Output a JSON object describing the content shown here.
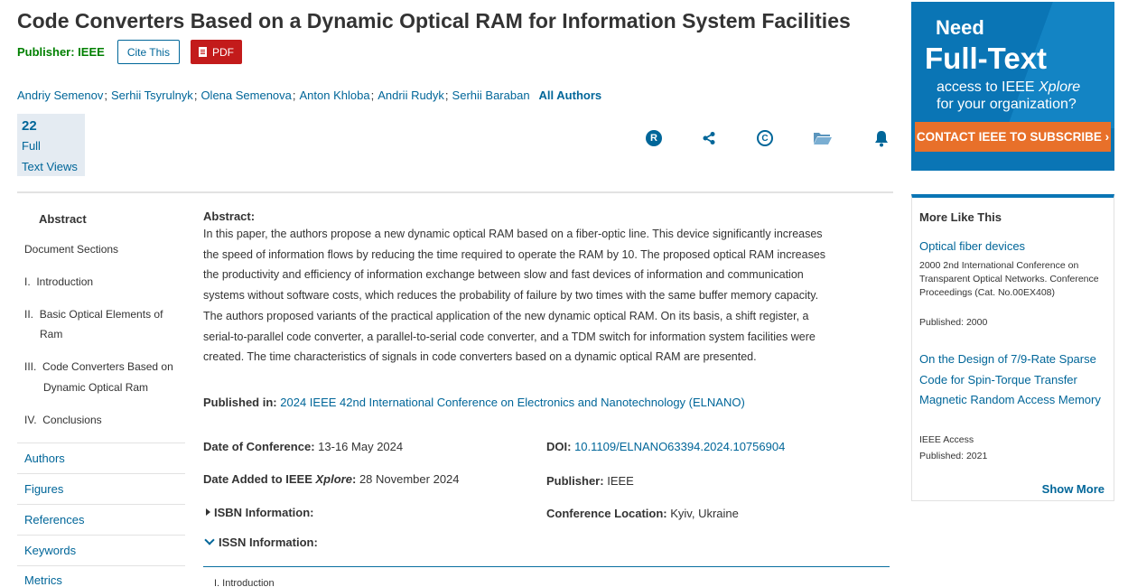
{
  "article": {
    "title": "Code Converters Based on a Dynamic Optical RAM for Information System Facilities",
    "publisher_label": "Publisher: IEEE",
    "cite_label": "Cite This",
    "pdf_label": "PDF",
    "authors": [
      "Andriy Semenov",
      "Serhii Tsyrulnyk",
      "Olena Semenova",
      "Anton Khloba",
      "Andrii Rudyk",
      "Serhii Baraban"
    ],
    "author_sep": ";",
    "all_authors_label": "All Authors",
    "views_count": "22",
    "views_label_1": "Full",
    "views_label_2": "Text Views"
  },
  "toolbar_icons": [
    "rights-icon",
    "share-icon",
    "copyright-icon",
    "folder-icon",
    "alert-bell-icon"
  ],
  "toolbar": {
    "rights_glyph": "R",
    "copyright_glyph": "C"
  },
  "nav": {
    "abstract": "Abstract",
    "document_sections": "Document Sections",
    "sections": [
      {
        "num": "I.",
        "title": "Introduction"
      },
      {
        "num": "II.",
        "title": "Basic Optical Elements of",
        "title2": "Ram"
      },
      {
        "num": "III.",
        "title": "Code Converters Based on",
        "title2": "Dynamic Optical Ram"
      },
      {
        "num": "IV.",
        "title": "Conclusions"
      }
    ],
    "links": [
      "Authors",
      "Figures",
      "References",
      "Keywords",
      "Metrics"
    ]
  },
  "abstract": {
    "heading": "Abstract:",
    "lines": [
      "In this paper, the authors propose a new dynamic optical RAM based on a fiber-optic line. This device significantly increases",
      "the speed of information flows by reducing the time required to operate the RAM by 10. The proposed optical RAM increases",
      "the productivity and efficiency of information exchange between slow and fast devices of information and communication",
      "systems without software costs, which reduces the probability of failure by two times with the same buffer memory capacity.",
      "The authors proposed variants of the practical application of the new dynamic optical RAM. On its basis, a shift register, a",
      "serial-to-parallel code converter, a parallel-to-serial code converter, and a TDM switch for information system facilities were",
      "created. The time characteristics of signals in code converters based on a dynamic optical RAM are presented."
    ]
  },
  "meta": {
    "published_in_label": "Published in:",
    "published_in_value": "2024 IEEE 42nd International Conference on Electronics and Nanotechnology (ELNANO)",
    "date_conf_label": "Date of Conference:",
    "date_conf_value": "13-16 May 2024",
    "doi_label": "DOI:",
    "doi_value": "10.1109/ELNANO63394.2024.10756904",
    "date_added_label_a": "Date Added to IEEE",
    "date_added_label_b": "Xplore",
    "date_added_label_c": ":",
    "date_added_value": "28 November 2024",
    "publisher_label": "Publisher:",
    "publisher_value": "IEEE",
    "isbn_label": "ISBN Information:",
    "location_label": "Conference Location:",
    "location_value": "Kyiv, Ukraine",
    "issn_label": "ISSN Information:",
    "intro_crumb": "I. Introduction"
  },
  "ad": {
    "need": "Need",
    "full_text": "Full-Text",
    "line1a": "access to IEEE ",
    "line1b": "Xplore",
    "line2": "for your organization?",
    "cta": "CONTACT IEEE TO SUBSCRIBE ›"
  },
  "more_like_this": {
    "heading": "More Like This",
    "items": [
      {
        "title": "Optical fiber devices",
        "source": "2000 2nd International Conference on Transparent Optical Networks. Conference Proceedings (Cat. No.00EX408)",
        "published": "Published: 2000"
      },
      {
        "title": "On the Design of 7/9-Rate Sparse Code for Spin-Torque Transfer Magnetic Random Access Memory",
        "source": "IEEE Access",
        "published": "Published: 2021"
      }
    ],
    "show_more": "Show More"
  }
}
